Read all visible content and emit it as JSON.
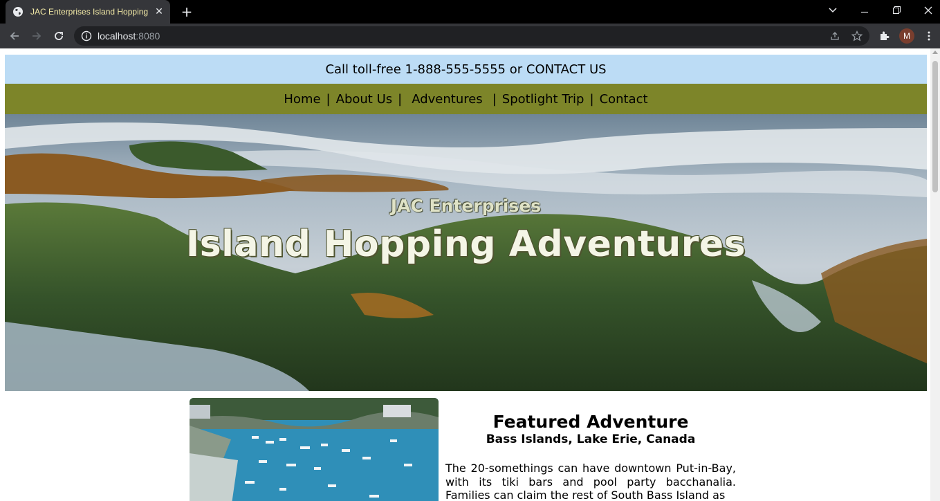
{
  "browser": {
    "tab_title": "JAC Enterprises Island Hopping A",
    "url_host": "localhost",
    "url_port": ":8080",
    "avatar_initial": "M"
  },
  "page": {
    "topbar": {
      "call_text": "Call toll-free 1-888-555-5555 or ",
      "contact_link": "CONTACT US"
    },
    "nav": {
      "items": [
        "Home",
        "About Us",
        "Adventures",
        "Spotlight Trip",
        "Contact"
      ],
      "separator": "|"
    },
    "hero": {
      "subtitle": "JAC Enterprises",
      "title": "Island Hopping Adventures"
    },
    "feature": {
      "heading": "Featured Adventure",
      "subheading": "Bass Islands, Lake Erie, Canada",
      "body": "The 20-somethings can have downtown Put-in-Bay, with its tiki bars and pool party bacchanalia. Families can claim the rest of South Bass Island as"
    }
  },
  "colors": {
    "topbar_bg": "#bcdcf5",
    "nav_bg": "#7d8529",
    "tab_title": "#f2e9a6"
  }
}
